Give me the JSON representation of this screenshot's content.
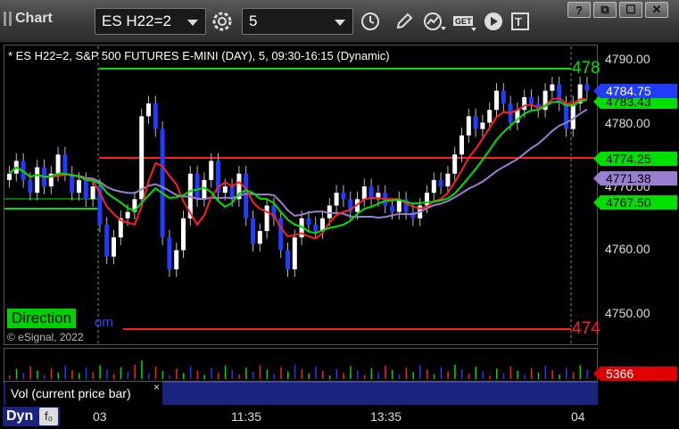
{
  "app": {
    "title": "Chart"
  },
  "toolbar": {
    "symbol_value": "ES H22=2",
    "interval_value": "5",
    "icons": [
      "settings-gear-icon",
      "clock-icon",
      "pencil-icon",
      "study-icon",
      "get-icon",
      "play-icon",
      "text-tool-icon"
    ],
    "window_buttons": [
      "?",
      "⧉",
      "☐",
      "✕"
    ]
  },
  "chart": {
    "symbol_line": "* ES H22=2, S&P 500 FUTURES E-MINI (DAY), 5, 09:30-16:15 (Dynamic)",
    "copyright": "© eSignal, 2022",
    "direction_label": "Direction",
    "clipped_text": "om",
    "price_ticks": [
      "4790.00",
      "4780.00",
      "4770.00",
      "4760.00",
      "4750.00"
    ],
    "price_tags": {
      "last": "4784.75",
      "green_upper": "4783.43",
      "green_mid": "4774.25",
      "purple": "4771.38",
      "green_lower": "4767.50"
    },
    "line_labels": {
      "top_green": "478",
      "bottom_red": "474"
    },
    "time_ticks": [
      "03",
      "11:35",
      "13:35",
      "04"
    ],
    "colors": {
      "up_candle": "#ffffff",
      "down_candle": "#1f3cff",
      "fast_ma": "#00e000",
      "red_ma": "#ff2020",
      "purple_ma": "#9a7fd0",
      "tag_green": "#00e000",
      "tag_blue": "#1f3cff",
      "tag_purple": "#9a7fd0",
      "vol_tag": "#e00000"
    }
  },
  "volume": {
    "label": "Vol (current price bar)",
    "close_glyph": "×",
    "value": "5366"
  },
  "bottom": {
    "dyn_label": "Dyn",
    "fx_label": "f₀"
  }
}
